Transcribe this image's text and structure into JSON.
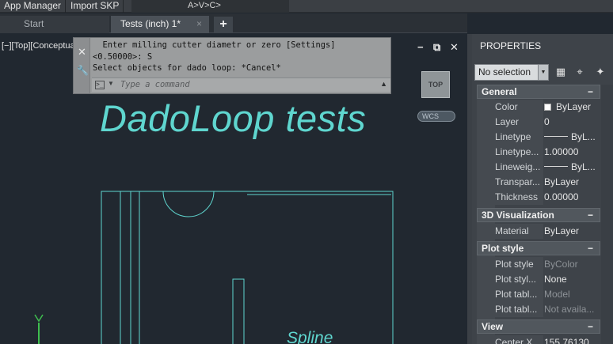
{
  "ribbon": {
    "app_manager": "App Manager",
    "import_skp": "Import SKP",
    "shortcut_hint": "A>V>C>"
  },
  "tabs": {
    "start": "Start",
    "active": "Tests (inch) 1*",
    "close_glyph": "×",
    "plus_glyph": "+"
  },
  "viewport": {
    "label": "[−][Top][Conceptual]",
    "view_cube": "TOP",
    "wcs": "WCS",
    "title_text": "DadoLoop tests",
    "spline_text": "Spline",
    "min_glyph": "−",
    "restore_glyph": "⧉",
    "close_glyph": "✕",
    "drawing_color": "#5fd6cf",
    "text_color": "#5fd6cf"
  },
  "command": {
    "line1": "  Enter milling cutter diametr or zero [Settings]",
    "line2": "<0.50000>: S",
    "line3": "Select objects for dado loop: *Cancel*",
    "placeholder": "Type a command",
    "close_glyph": "✕"
  },
  "properties": {
    "title": "PROPERTIES",
    "selection": "No selection",
    "sections": {
      "general": "General",
      "visualization": "3D Visualization",
      "plot_style": "Plot style",
      "view": "View"
    },
    "collapse_glyph": "−",
    "general_rows": [
      {
        "key": "Color",
        "value": "ByLayer"
      },
      {
        "key": "Layer",
        "value": "0"
      },
      {
        "key": "Linetype",
        "value": "ByL..."
      },
      {
        "key": "Linetype...",
        "value": "1.00000"
      },
      {
        "key": "Lineweig...",
        "value": "ByL..."
      },
      {
        "key": "Transpar...",
        "value": "ByLayer"
      },
      {
        "key": "Thickness",
        "value": "0.00000"
      }
    ],
    "visualization_rows": [
      {
        "key": "Material",
        "value": "ByLayer"
      }
    ],
    "plot_rows": [
      {
        "key": "Plot style",
        "value": "ByColor"
      },
      {
        "key": "Plot styl...",
        "value": "None"
      },
      {
        "key": "Plot tabl...",
        "value": "Model"
      },
      {
        "key": "Plot tabl...",
        "value": "Not availa..."
      }
    ],
    "view_rows": [
      {
        "key": "Center X",
        "value": "155.76130"
      }
    ]
  }
}
